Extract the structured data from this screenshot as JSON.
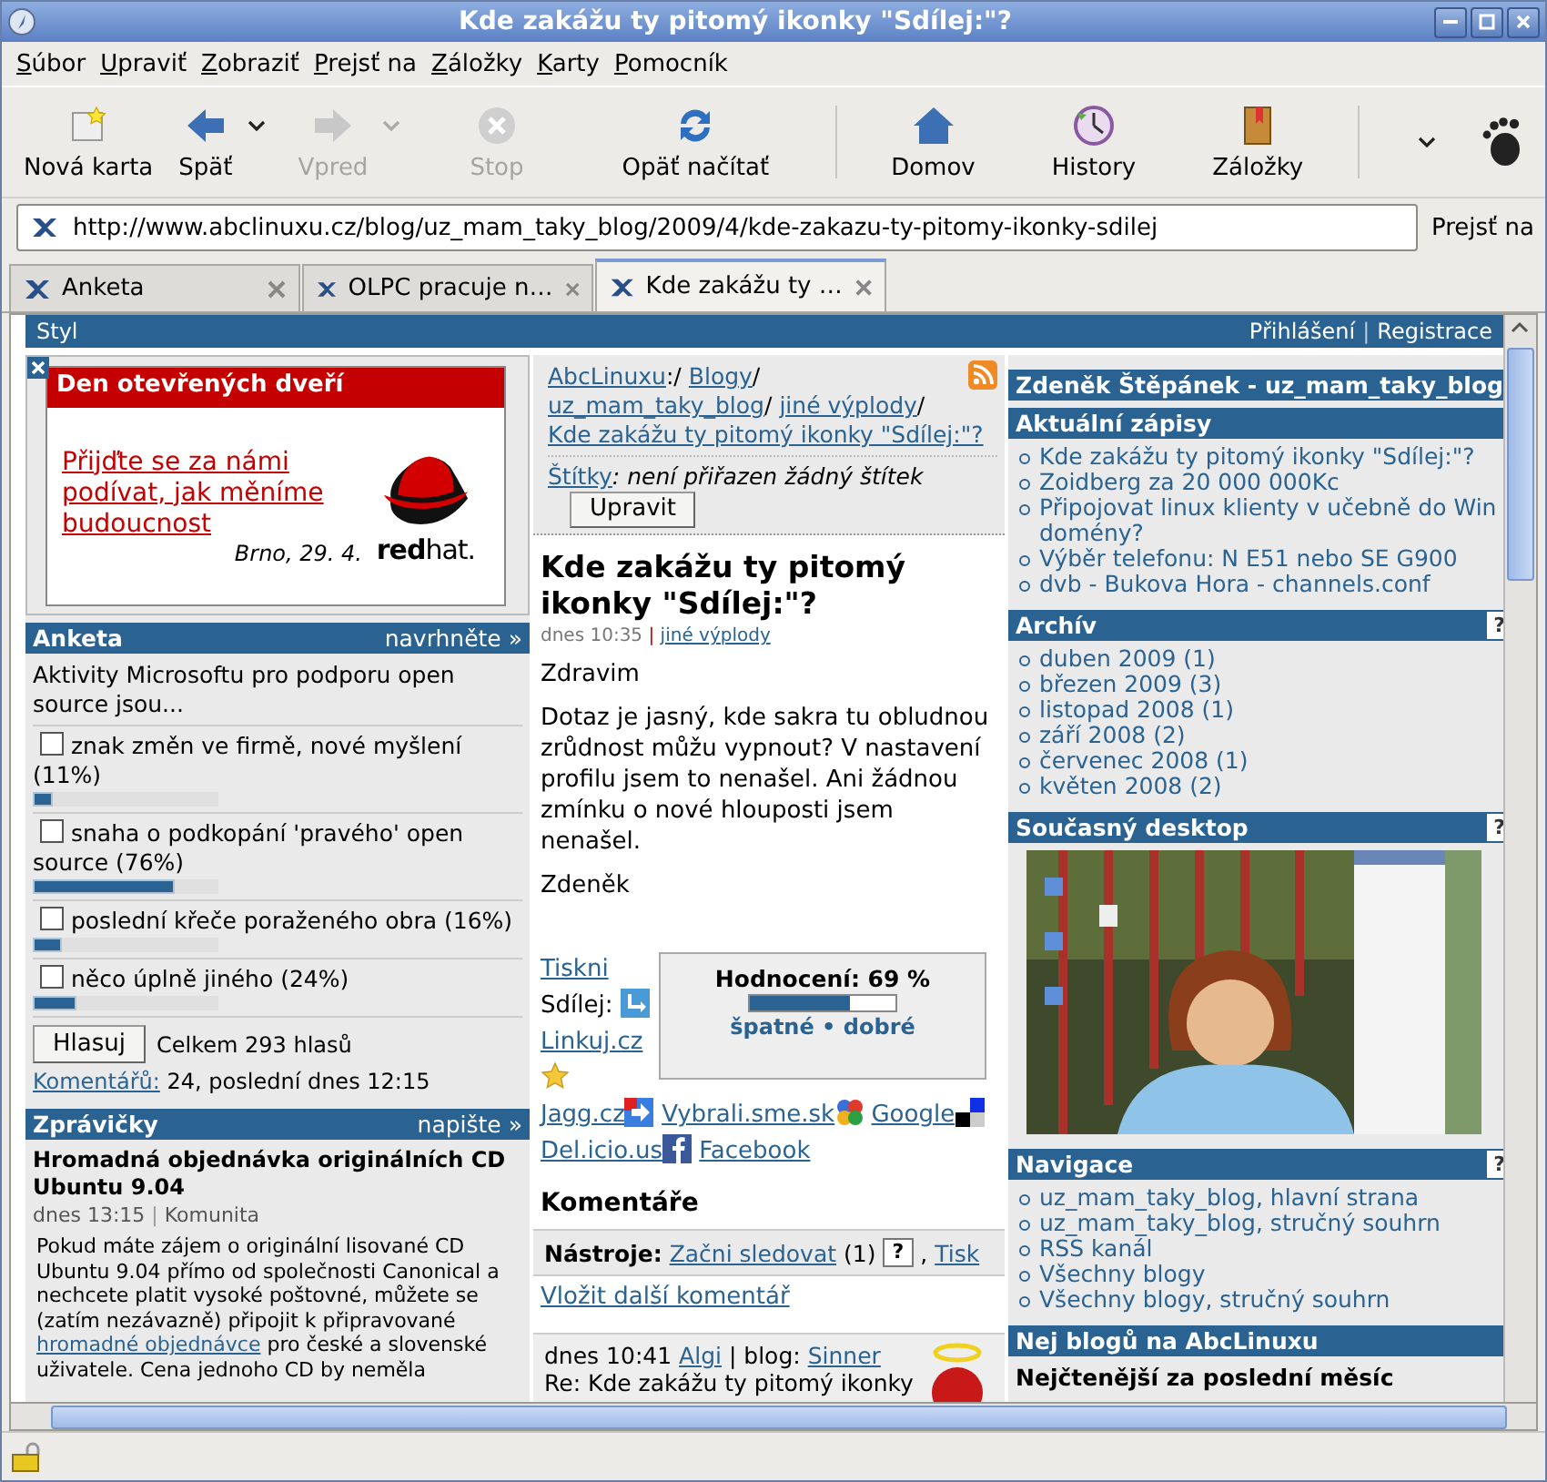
{
  "window": {
    "title": "Kde zakážu ty pitomý ikonky \"Sdílej:\"?"
  },
  "menu": [
    "Súbor",
    "Upraviť",
    "Zobraziť",
    "Prejsť na",
    "Záložky",
    "Karty",
    "Pomocník"
  ],
  "toolbar": [
    {
      "kind": "new-tab",
      "label": "Nová karta",
      "disabled": false,
      "dropdown": false,
      "separator_after": false
    },
    {
      "kind": "back",
      "label": "Späť",
      "disabled": false,
      "dropdown": true,
      "separator_after": false
    },
    {
      "kind": "forward",
      "label": "Vpred",
      "disabled": true,
      "dropdown": true,
      "separator_after": false
    },
    {
      "kind": "stop",
      "label": "Stop",
      "disabled": true,
      "dropdown": false,
      "separator_after": false
    },
    {
      "kind": "reload",
      "label": "Opäť načítať",
      "disabled": false,
      "dropdown": false,
      "separator_after": true
    },
    {
      "kind": "home",
      "label": "Domov",
      "disabled": false,
      "dropdown": false,
      "separator_after": false
    },
    {
      "kind": "history",
      "label": "History",
      "disabled": false,
      "dropdown": false,
      "separator_after": false
    },
    {
      "kind": "bookmarks",
      "label": "Záložky",
      "disabled": false,
      "dropdown": false,
      "separator_after": true
    }
  ],
  "address": {
    "url": "http://www.abclinuxu.cz/blog/uz_mam_taky_blog/2009/4/kde-zakazu-ty-pitomy-ikonky-sdilej",
    "go": "Prejsť na"
  },
  "tabs": [
    {
      "label": "Anketa",
      "selected": false
    },
    {
      "label": "OLPC pracuje n…",
      "selected": false
    },
    {
      "label": "Kde zakážu ty …",
      "selected": true
    }
  ],
  "topbar": {
    "left": "Styl",
    "links": [
      "Přihlášení",
      "Registrace"
    ],
    "divider": "|"
  },
  "ad": {
    "title": "Den otevřených dveří",
    "link": "Přijďte se za námi podívat, jak měníme budoucnost",
    "note": "Brno, 29. 4.",
    "logo_text": "**red**hat."
  },
  "poll": {
    "title": "Anketa",
    "action": "navrhněte »",
    "question": "Aktivity Microsoftu pro podporu open source jsou...",
    "options": [
      {
        "label": "znak změn ve firmě, nové myšlení (11%)",
        "checked": false,
        "level": 0.11
      },
      {
        "label": "snaha o podkopání 'pravého' open source (76%)",
        "checked": false,
        "level": 0.76
      },
      {
        "label": "poslední křeče poraženého obra (16%)",
        "checked": false,
        "level": 0.16
      },
      {
        "label": "něco úplně jiného (24%)",
        "checked": false,
        "level": 0.24
      }
    ],
    "vote": "Hlasuj",
    "total": "Celkem 293 hlasů",
    "comments_link": "Komentářů:",
    "comments_text": "24, poslední dnes 12:15"
  },
  "news": {
    "title": "Zprávičky",
    "action": "napište »",
    "items": [
      {
        "headline": "Hromadná objednávka originálních CD Ubuntu 9.04",
        "time": "dnes 13:15",
        "divider": "|",
        "category": "Komunita",
        "text_before": "Pokud máte zájem o originální lisované CD Ubuntu 9.04 přímo od společnosti Canonical a nechcete platit vysoké poštovné, můžete se (zatím nezávazně) připojit k připravované",
        "link": "hromadné objednávce",
        "text_after": "pro české a slovenské uživatele. Cena jednoho CD by neměla"
      }
    ]
  },
  "breadcrumbs": [
    {
      "text": "AbcLinuxu",
      "sep": ":/"
    },
    {
      "text": "Blogy",
      "sep": "/"
    },
    {
      "text": "uz_mam_taky_blog",
      "sep": "/"
    },
    {
      "text": "jiné výplody",
      "sep": "/"
    },
    {
      "text": "Kde zakážu ty pitomý ikonky \"Sdílej:\"?"
    }
  ],
  "tags": {
    "label": "Štítky",
    "value": ": není přiřazen žádný štítek",
    "edit": "Upravit"
  },
  "article": {
    "title": "Kde zakážu ty pitomý ikonky \"Sdílej:\"?",
    "time": "dnes 10:35",
    "divider": "|",
    "category": "jiné výplody",
    "paragraphs": [
      "Zdravim",
      "Dotaz je jasný, kde sakra tu obludnou zrůdnost můžu vypnout? V nastavení profilu jsem to nenašel. Ani žádnou zmínku o nové hlouposti jsem nenašel.",
      "Zdeněk"
    ]
  },
  "share": {
    "print": "Tiskni",
    "label": "Sdílej:",
    "services": [
      {
        "kind": "linkuj",
        "label": "Linkuj.cz"
      },
      {
        "kind": "jagg",
        "label": "Jagg.cz"
      },
      {
        "kind": "vybrali",
        "label": "Vybrali.sme.sk"
      },
      {
        "kind": "google",
        "label": "Google"
      },
      {
        "kind": "delicious",
        "label": "Del.icio.us"
      },
      {
        "kind": "facebook",
        "label": "Facebook"
      }
    ]
  },
  "rating": {
    "label": "Hodnocení: 69 %",
    "level": 0.69,
    "bad": "špatné",
    "dot": "•",
    "good": "dobré"
  },
  "comments": {
    "title": "Komentáře",
    "tools_label": "Nástroje:",
    "follow": "Začni sledovat",
    "count": "(1)",
    "help": "?",
    "comma": ",",
    "print": "Tisk",
    "add": "Vložit další komentář",
    "items": [
      {
        "time": "dnes 10:41",
        "author": "Algi",
        "blog_label": "| blog:",
        "blog": "Sinner",
        "title": "Re: Kde zakážu ty pitomý ikonky"
      }
    ]
  },
  "sidebar": {
    "blog_title": "Zdeněk Štěpánek - uz_mam_taky_blog",
    "sections": [
      {
        "kind": "list",
        "title": "Aktuální zápisy",
        "items": [
          "Kde zakážu ty pitomý ikonky \"Sdílej:\"?",
          "Zoidberg za 20 000 000Kc",
          "Připojovat linux klienty v učebně do Win domény?",
          "Výběr telefonu: N E51 nebo SE G900",
          "dvb - Bukova Hora - channels.conf"
        ]
      },
      {
        "kind": "list",
        "title": "Archív",
        "help": "?",
        "items": [
          "duben 2009 (1)",
          "březen 2009 (3)",
          "listopad 2008 (1)",
          "září 2008 (2)",
          "červenec 2008 (1)",
          "květen 2008 (2)"
        ]
      },
      {
        "kind": "picture",
        "title": "Současný desktop",
        "help": "?"
      },
      {
        "kind": "list",
        "title": "Navigace",
        "help": "?",
        "items": [
          "uz_mam_taky_blog, hlavní strana",
          "uz_mam_taky_blog, stručný souhrn",
          "RSS kanál",
          "Všechny blogy",
          "Všechny blogy, stručný souhrn"
        ]
      },
      {
        "kind": "subheading",
        "title": "Nej blogů na AbcLinuxu",
        "subtitle": "Nejčtenější za poslední měsíc"
      }
    ]
  }
}
